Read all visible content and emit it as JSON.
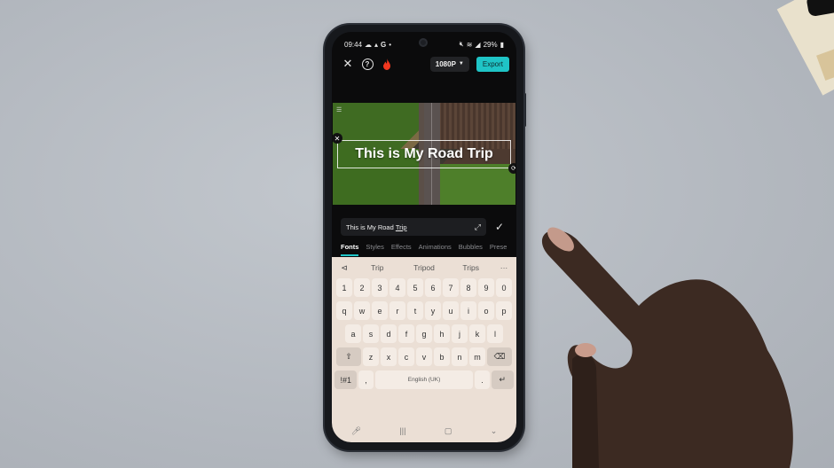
{
  "status_bar": {
    "time": "09:44",
    "left_icons": [
      "cloud-icon",
      "signal-icon",
      "google-icon",
      "dot-icon"
    ],
    "battery": "29%",
    "right_icons": [
      "mute-icon",
      "wifi-icon",
      "signal-icon",
      "battery-icon"
    ]
  },
  "top_bar": {
    "close_label": "✕",
    "help_label": "?",
    "resolution": "1080P",
    "export_label": "Export"
  },
  "preview": {
    "overlay_text": "This is My Road Trip"
  },
  "text_editor": {
    "value_prefix": "This is My Road ",
    "value_underlined": "Trip"
  },
  "tabs": [
    {
      "label": "Fonts",
      "active": true
    },
    {
      "label": "Styles"
    },
    {
      "label": "Effects"
    },
    {
      "label": "Animations"
    },
    {
      "label": "Bubbles"
    },
    {
      "label": "Prese"
    }
  ],
  "keyboard": {
    "suggestions": [
      "Trip",
      "Tripod",
      "Trips"
    ],
    "more_label": "···",
    "row_numbers": [
      "1",
      "2",
      "3",
      "4",
      "5",
      "6",
      "7",
      "8",
      "9",
      "0"
    ],
    "row_1": [
      "q",
      "w",
      "e",
      "r",
      "t",
      "y",
      "u",
      "i",
      "o",
      "p"
    ],
    "row_2": [
      "a",
      "s",
      "d",
      "f",
      "g",
      "h",
      "j",
      "k",
      "l"
    ],
    "row_3": [
      "z",
      "x",
      "c",
      "v",
      "b",
      "n",
      "m"
    ],
    "symbols_label": "!#1",
    "comma_label": ",",
    "space_label": "English (UK)",
    "period_label": ".",
    "shift_label": "⇧",
    "backspace_label": "⌫",
    "enter_label": "↵"
  },
  "nav_bar": {
    "mic": "🎙",
    "recents": "|||",
    "home": "▢",
    "back": "⌄"
  }
}
